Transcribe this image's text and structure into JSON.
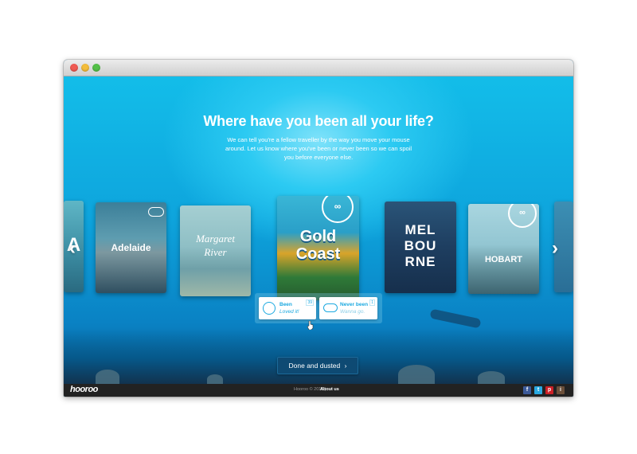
{
  "hero": {
    "heading": "Where have you been all your life?",
    "subtext": "We can tell you're a fellow traveller by the way you move your mouse around. Let us know where you've been or never been so we can spoil you before everyone else."
  },
  "cards": {
    "partial_left": "A",
    "adelaide": "Adelaide",
    "margaret_river_1": "Margaret",
    "margaret_river_2": "River",
    "gold_coast_1": "Gold",
    "gold_coast_2": "Coast",
    "melbourne_1": "MEL",
    "melbourne_2": "BOU",
    "melbourne_3": "RNE",
    "hobart": "HOBART"
  },
  "choices": {
    "been": {
      "title": "Been",
      "subtitle": "Loved it!",
      "count": "39"
    },
    "never": {
      "title": "Never been",
      "subtitle": "Wanna go.",
      "count": "1"
    }
  },
  "buttons": {
    "done": "Done and dusted",
    "prev_glyph": "‹",
    "next_glyph": "›",
    "done_glyph": "›"
  },
  "footer": {
    "logo": "hooroo",
    "copyright": "Hooroo © 2012 |",
    "about": "About us",
    "social": [
      {
        "label": "f",
        "color": "#3b5998"
      },
      {
        "label": "t",
        "color": "#29a9e1"
      },
      {
        "label": "p",
        "color": "#cb2027"
      },
      {
        "label": "i",
        "color": "#6b4f3a"
      }
    ]
  },
  "window": {
    "controls": [
      "close",
      "minimize",
      "zoom"
    ]
  }
}
